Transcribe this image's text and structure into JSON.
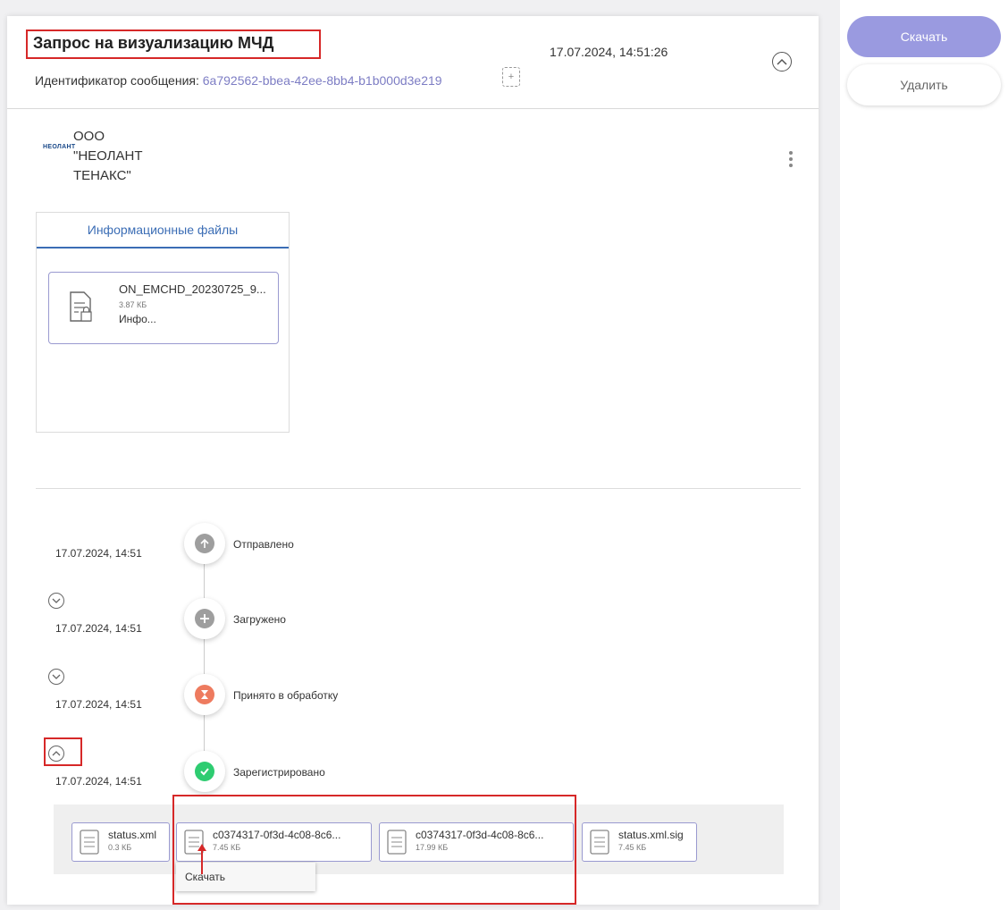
{
  "header": {
    "title": "Запрос на визуализацию МЧД",
    "message_id_label": "Идентификатор сообщения:",
    "message_id": "6a792562-bbea-42ee-8bb4-b1b000d3e219",
    "date": "17.07.2024, 14:51:26"
  },
  "sender": {
    "logo_text": "НЕОЛАНТ",
    "name_line1": "ООО",
    "name_line2": "\"НЕОЛАНТ",
    "name_line3": "ТЕНАКС\""
  },
  "files": {
    "tab_label": "Информационные файлы",
    "items": [
      {
        "name": "ON_EMCHD_20230725_9...",
        "size": "3.87 КБ",
        "type": "Инфо..."
      }
    ]
  },
  "timeline": [
    {
      "date": "17.07.2024, 14:51",
      "status": "Отправлено",
      "color": "#9e9e9e",
      "icon": "arrow-up-icon"
    },
    {
      "date": "17.07.2024, 14:51",
      "status": "Загружено",
      "color": "#9e9e9e",
      "icon": "plus-icon"
    },
    {
      "date": "17.07.2024, 14:51",
      "status": "Принято в обработку",
      "color": "#ee7b5f",
      "icon": "hourglass-icon"
    },
    {
      "date": "17.07.2024, 14:51",
      "status": "Зарегистрировано",
      "color": "#2ecc71",
      "icon": "check-icon"
    }
  ],
  "attachments": [
    {
      "name": "status.xml",
      "size": "0.3 КБ"
    },
    {
      "name": "c0374317-0f3d-4c08-8c6...",
      "size": "7.45 КБ"
    },
    {
      "name": "c0374317-0f3d-4c08-8c6...",
      "size": "17.99 КБ"
    },
    {
      "name": "status.xml.sig",
      "size": "7.45 КБ"
    }
  ],
  "context_menu": {
    "download_label": "Скачать"
  },
  "actions": {
    "download_label": "Скачать",
    "delete_label": "Удалить"
  },
  "colors": {
    "accent": "#9a9ae0",
    "link": "#7d7dc4",
    "highlight_box": "#d62828",
    "tab_active": "#3b6db5"
  }
}
